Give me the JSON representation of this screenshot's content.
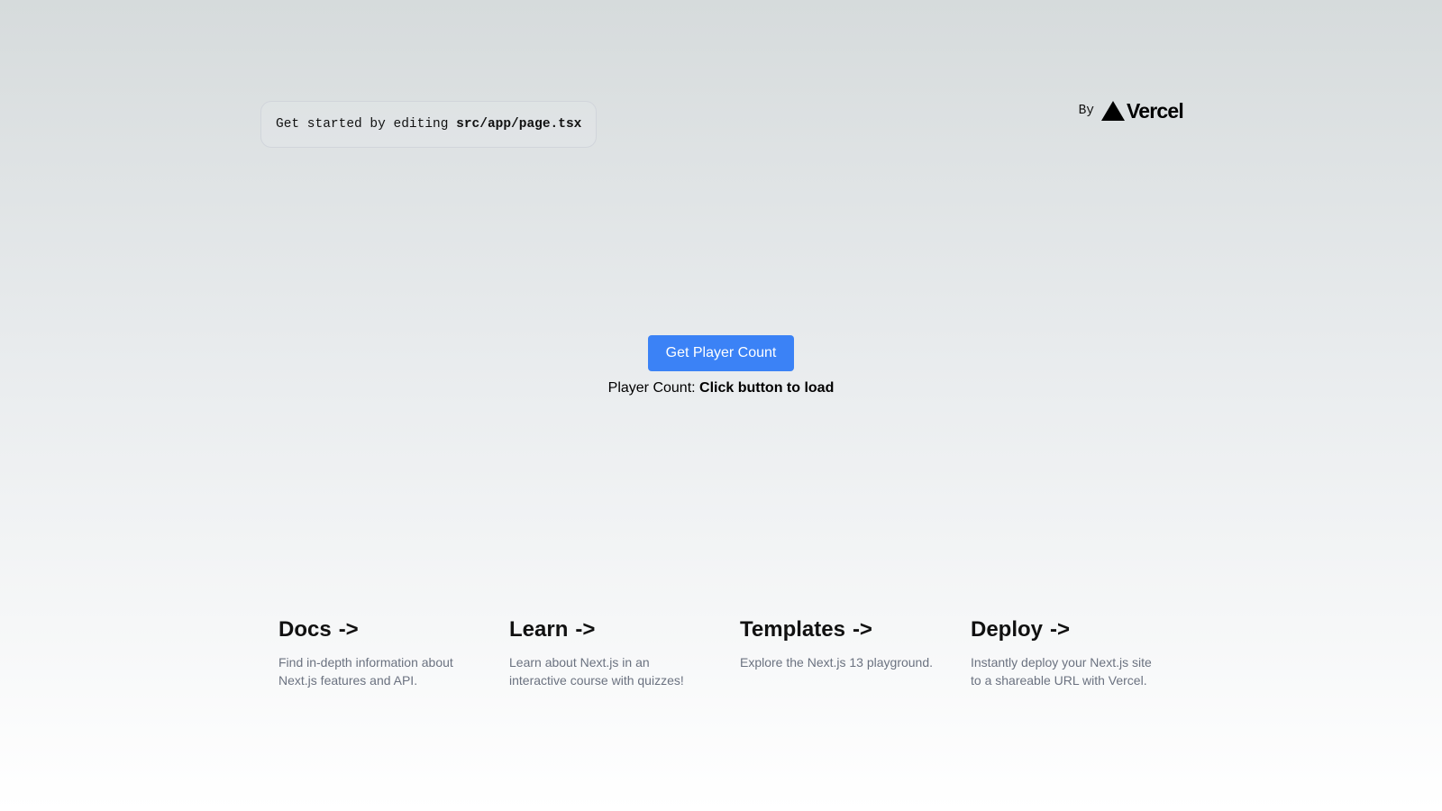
{
  "header": {
    "get_started_prefix": "Get started by editing ",
    "get_started_file": "src/app/page.tsx",
    "by_label": "By",
    "vercel_label": "Vercel"
  },
  "main": {
    "button_label": "Get Player Count",
    "player_count_label": "Player Count: ",
    "player_count_value": "Click button to load"
  },
  "cards": [
    {
      "title": "Docs",
      "arrow": "->",
      "description": "Find in-depth information about Next.js features and API."
    },
    {
      "title": "Learn",
      "arrow": "->",
      "description": "Learn about Next.js in an interactive course with quizzes!"
    },
    {
      "title": "Templates",
      "arrow": "->",
      "description": "Explore the Next.js 13 playground."
    },
    {
      "title": "Deploy",
      "arrow": "->",
      "description": "Instantly deploy your Next.js site to a shareable URL with Vercel."
    }
  ],
  "colors": {
    "button_bg": "#3b82f6",
    "description_text": "#6b7280"
  },
  "icons": {
    "vercel_logo": "vercel-triangle-icon"
  }
}
